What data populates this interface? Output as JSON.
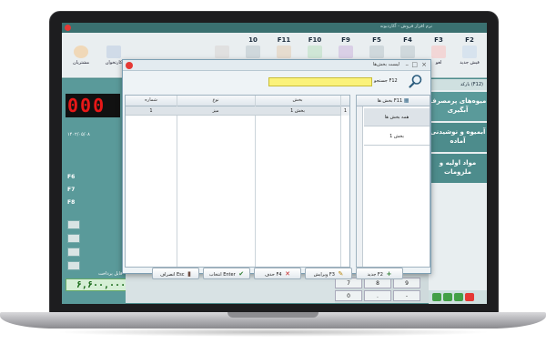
{
  "app": {
    "title": "نرم افزار فروش - آکاردیونه"
  },
  "toolbar": {
    "buttons": [
      {
        "key": "F2",
        "label": "فیش جدید"
      },
      {
        "key": "F3",
        "label": "لغو"
      },
      {
        "key": "F4",
        "label": ""
      },
      {
        "key": "F5",
        "label": ""
      },
      {
        "key": "F9",
        "label": ""
      },
      {
        "key": "F10",
        "label": ""
      },
      {
        "key": "F11",
        "label": ""
      },
      {
        "key": "10",
        "label": ""
      },
      {
        "key": "",
        "label": ""
      },
      {
        "key": "",
        "label": "کارتخوان"
      },
      {
        "key": "",
        "label": "مشتریان"
      }
    ]
  },
  "left_panel": {
    "counter": "000",
    "date": "۱۴۰۲/۰۵/۰۸",
    "fkeys": [
      "F6",
      "F7",
      "F8"
    ],
    "total_label": "قابل پرداخت",
    "total_value": "۶,۶۰۰,۰۰۰"
  },
  "right_panel": {
    "header": "بارکد (F12)",
    "categories": [
      {
        "label": "میوه‌های پرمصرف آبگیری",
        "color": "#5a9a9a"
      },
      {
        "label": "آبمیوه و نوشیدنی آماده",
        "color": "#4d8c8c"
      },
      {
        "label": "مواد اولیه و ملزومات",
        "color": "#4d8c8c"
      }
    ]
  },
  "numpad": {
    "keys": [
      "7",
      "8",
      "9",
      "-",
      "0",
      "."
    ]
  },
  "dialog": {
    "title": "لیست بخش‌ها",
    "controls": {
      "minimize": "–",
      "maximize": "□",
      "close": "×"
    },
    "search": {
      "label": "جستجو F12",
      "value": ""
    },
    "grid": {
      "columns": [
        "شماره",
        "نوع",
        "بخش"
      ],
      "rows": [
        {
          "number": "1",
          "type": "میز",
          "section": "بخش 1",
          "indicator": "1"
        }
      ]
    },
    "side_list": {
      "header": "بخش ها F11",
      "items": [
        "همه بخش ها",
        "بخش 1"
      ]
    },
    "buttons": [
      {
        "label": "جدید F2",
        "icon": "plus-icon",
        "color": "#2e7d32",
        "glyph": "+"
      },
      {
        "label": "ویرایش F3",
        "icon": "pencil-icon",
        "color": "#b8860b",
        "glyph": "✎"
      },
      {
        "label": "حذف F4",
        "icon": "delete-icon",
        "color": "#c62828",
        "glyph": "✕"
      },
      {
        "label": "انتخاب Enter",
        "icon": "check-icon",
        "color": "#2e7d32",
        "glyph": "✔"
      },
      {
        "label": "انصراف Esc",
        "icon": "exit-icon",
        "color": "#6d4c41",
        "glyph": "▮"
      }
    ]
  }
}
